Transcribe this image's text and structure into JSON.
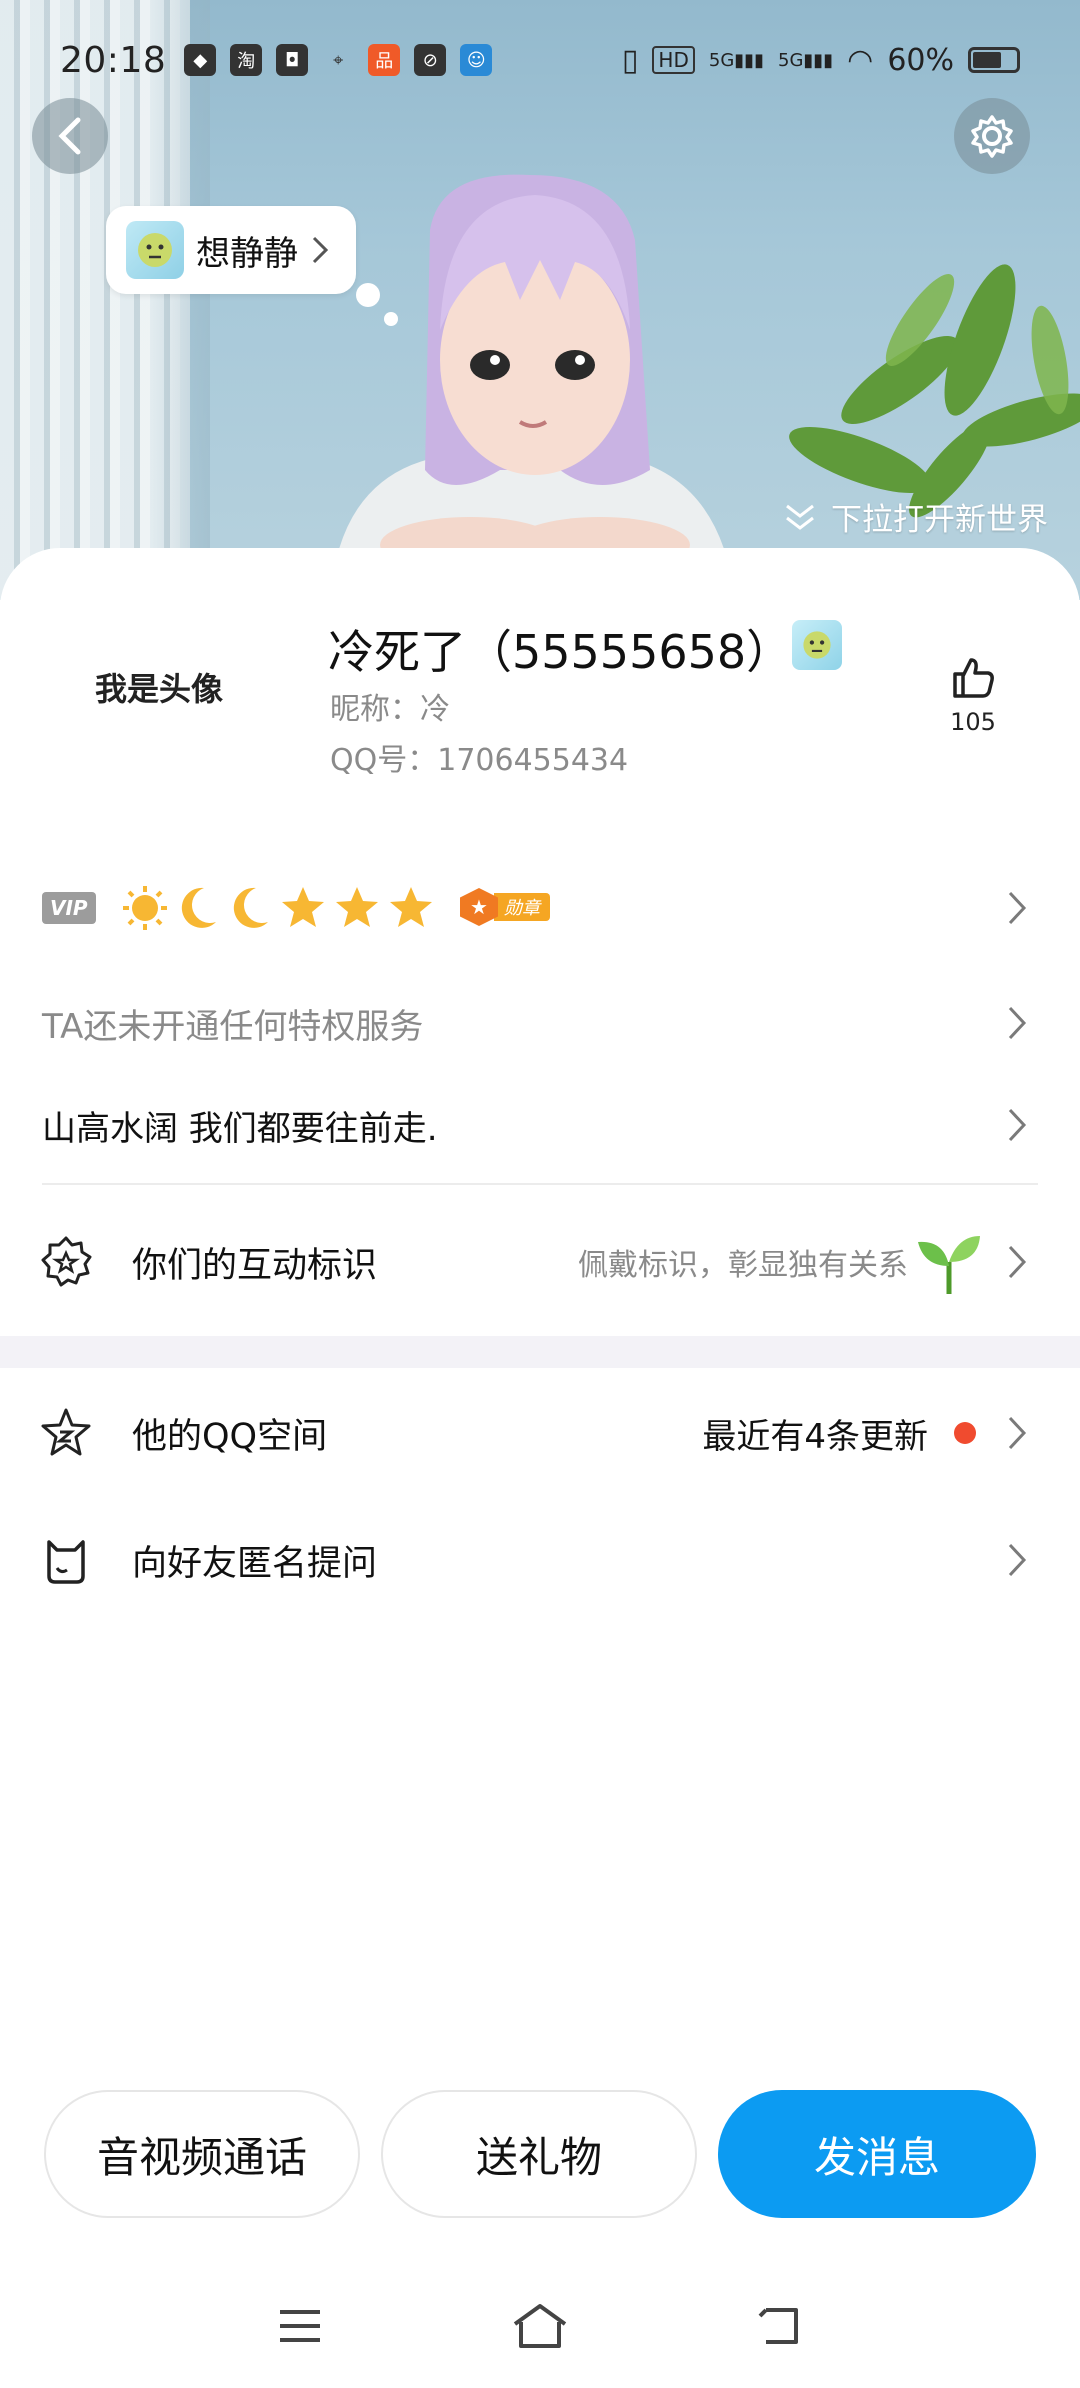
{
  "status_bar": {
    "time": "20:18",
    "battery": "60%",
    "battery_level": 0.6,
    "network": "5G"
  },
  "header": {
    "mood_label": "想静静",
    "pull_hint": "下拉打开新世界"
  },
  "profile": {
    "avatar_placeholder": "我是头像",
    "name": "冷死了（55555658）",
    "nickname": "昵称：冷",
    "qq_number": "QQ号：1706455434",
    "like_count": "105"
  },
  "level": {
    "vip_tag": "VIP",
    "badges": [
      "sun-icon",
      "moon-icon",
      "moon-icon",
      "star-icon",
      "star-icon",
      "star-icon"
    ],
    "medal_label": "勋章"
  },
  "rows": {
    "privilege_text": "TA还未开通任何特权服务",
    "signature": "山高水阔 我们都要往前走.",
    "interaction_label": "你们的互动标识",
    "interaction_hint": "佩戴标识，彰显独有关系",
    "qzone_label": "他的QQ空间",
    "qzone_hint": "最近有4条更新",
    "ask_label": "向好友匿名提问"
  },
  "actions": {
    "call": "音视频通话",
    "gift": "送礼物",
    "message": "发消息"
  },
  "colors": {
    "primary": "#0c9bf2",
    "badge_red": "#f04b2f",
    "medal_orange": "#f07a22"
  }
}
